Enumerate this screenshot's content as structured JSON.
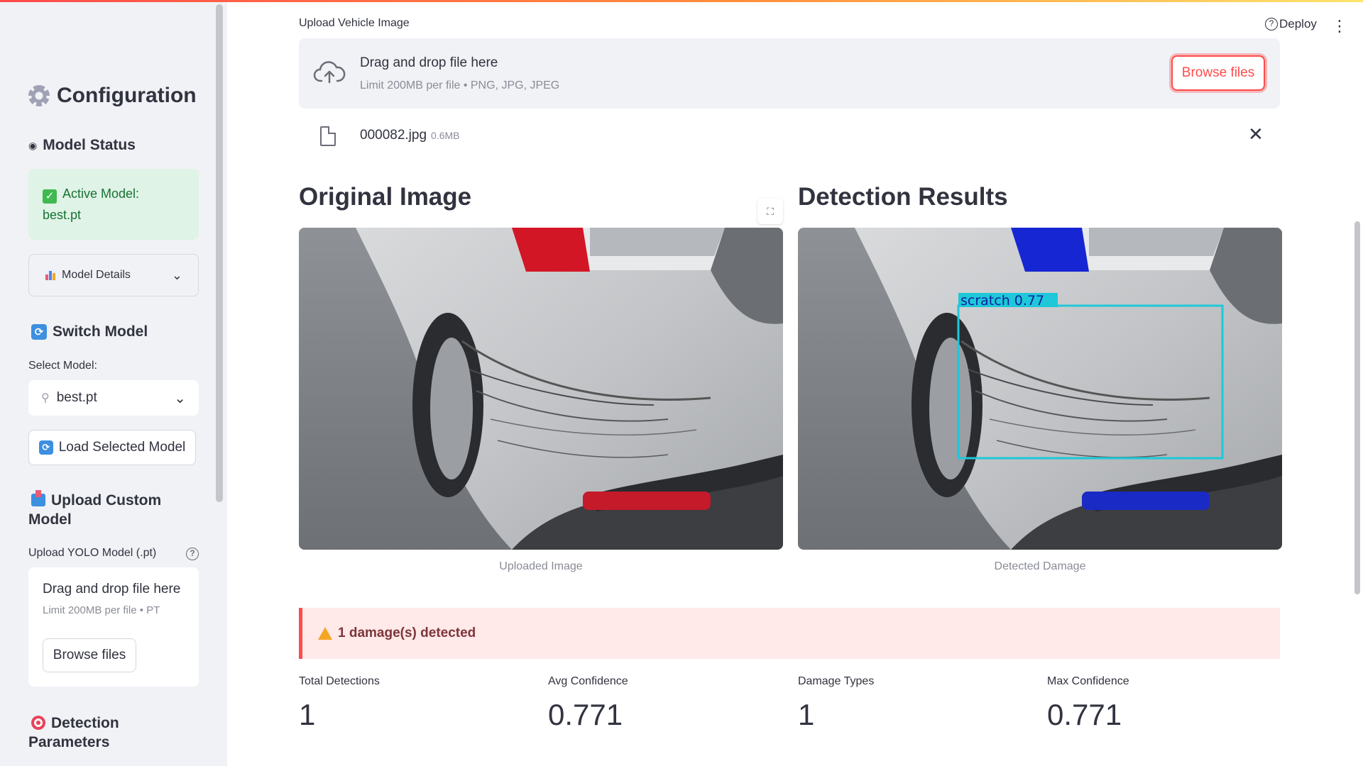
{
  "sidebar": {
    "title": "Configuration",
    "model_status_heading": "Model Status",
    "status_line1": "Active Model:",
    "status_line2": "best.pt",
    "model_details_label": "Model Details",
    "switch_model_heading": "Switch Model",
    "select_model_label": "Select Model:",
    "selected_model": "best.pt",
    "load_button": "Load Selected Model",
    "upload_custom_heading_1": "Upload Custom",
    "upload_custom_heading_2": "Model",
    "upload_yolo_label": "Upload YOLO Model (.pt)",
    "drop_text": "Drag and drop file here",
    "drop_limit": "Limit 200MB per file • PT",
    "browse_button": "Browse files",
    "detection_heading_1": "Detection",
    "detection_heading_2": "Parameters"
  },
  "header": {
    "deploy": "Deploy"
  },
  "main": {
    "upload_label": "Upload Vehicle Image",
    "drop_text": "Drag and drop file here",
    "drop_limit": "Limit 200MB per file • PNG, JPG, JPEG",
    "browse_button": "Browse files",
    "file_name": "000082.jpg",
    "file_size": "0.6MB",
    "original_heading": "Original Image",
    "detection_heading": "Detection Results",
    "original_caption": "Uploaded Image",
    "detection_caption": "Detected Damage",
    "bbox_label": "scratch  0.77",
    "alert_text": "1 damage(s) detected",
    "metrics": [
      {
        "label": "Total Detections",
        "value": "1"
      },
      {
        "label": "Avg Confidence",
        "value": "0.771"
      },
      {
        "label": "Damage Types",
        "value": "1"
      },
      {
        "label": "Max Confidence",
        "value": "0.771"
      }
    ]
  },
  "colors": {
    "accent": "#ff4b4b",
    "success_bg": "#dff3e6",
    "bbox": "#1ec8d8"
  }
}
